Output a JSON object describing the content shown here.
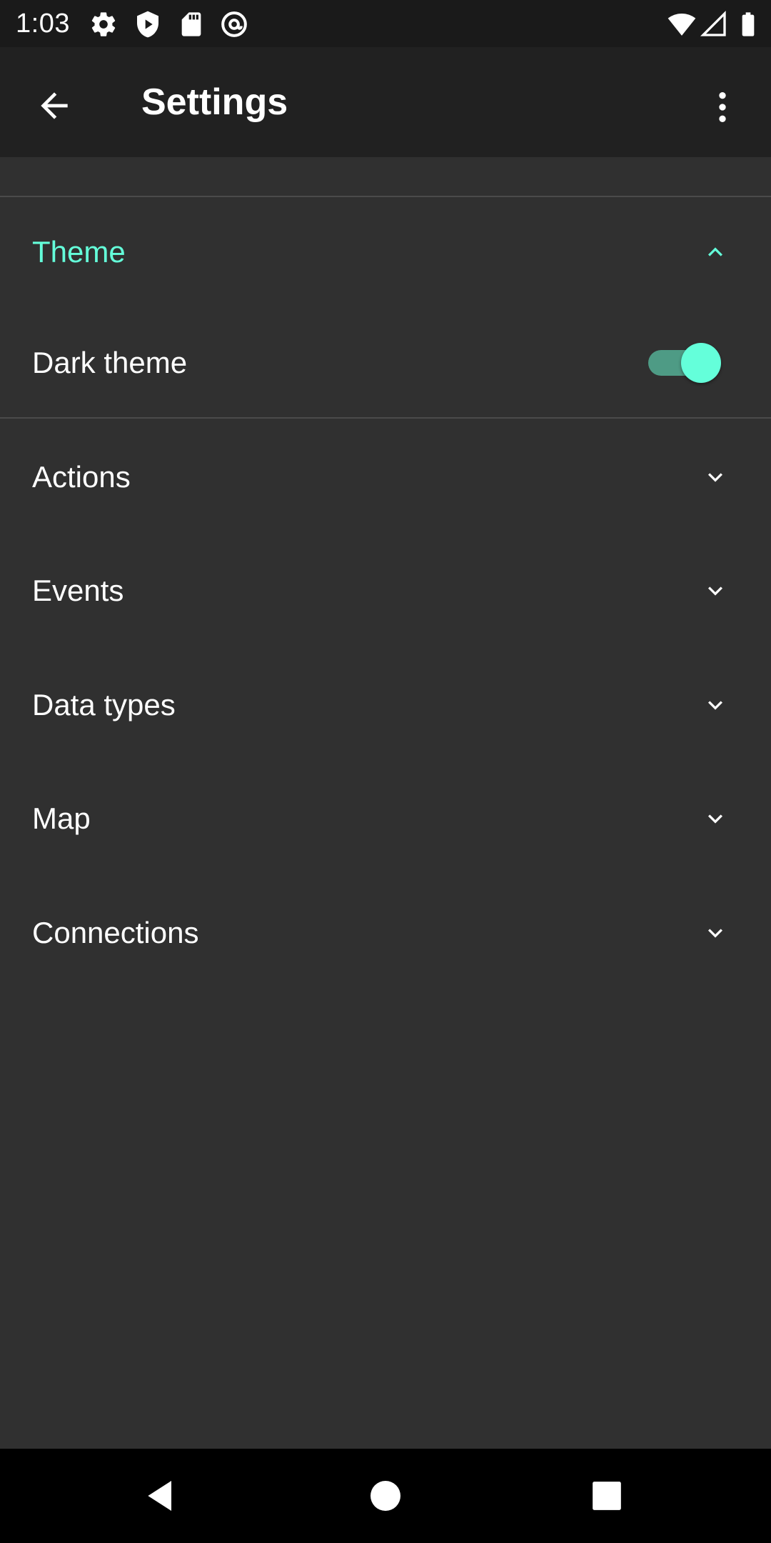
{
  "status_bar": {
    "time": "1:03",
    "left_icons": [
      "gear-icon",
      "shield-icon",
      "sd-card-icon",
      "at-sign-icon"
    ],
    "right_icons": [
      "wifi-icon",
      "signal-icon",
      "battery-icon"
    ]
  },
  "app_bar": {
    "title": "Settings",
    "back_icon": "arrow-back-icon",
    "menu_icon": "more-vert-icon"
  },
  "sections": [
    {
      "label": "Theme",
      "expanded": true
    },
    {
      "label": "Actions",
      "expanded": false
    },
    {
      "label": "Events",
      "expanded": false
    },
    {
      "label": "Data types",
      "expanded": false
    },
    {
      "label": "Map",
      "expanded": false
    },
    {
      "label": "Connections",
      "expanded": false
    }
  ],
  "theme": {
    "dark_theme_label": "Dark theme",
    "dark_theme_enabled": true
  },
  "colors": {
    "accent": "#64ffda",
    "background": "#303030",
    "app_bar": "#212121",
    "status_bar": "#1a1a1a"
  }
}
